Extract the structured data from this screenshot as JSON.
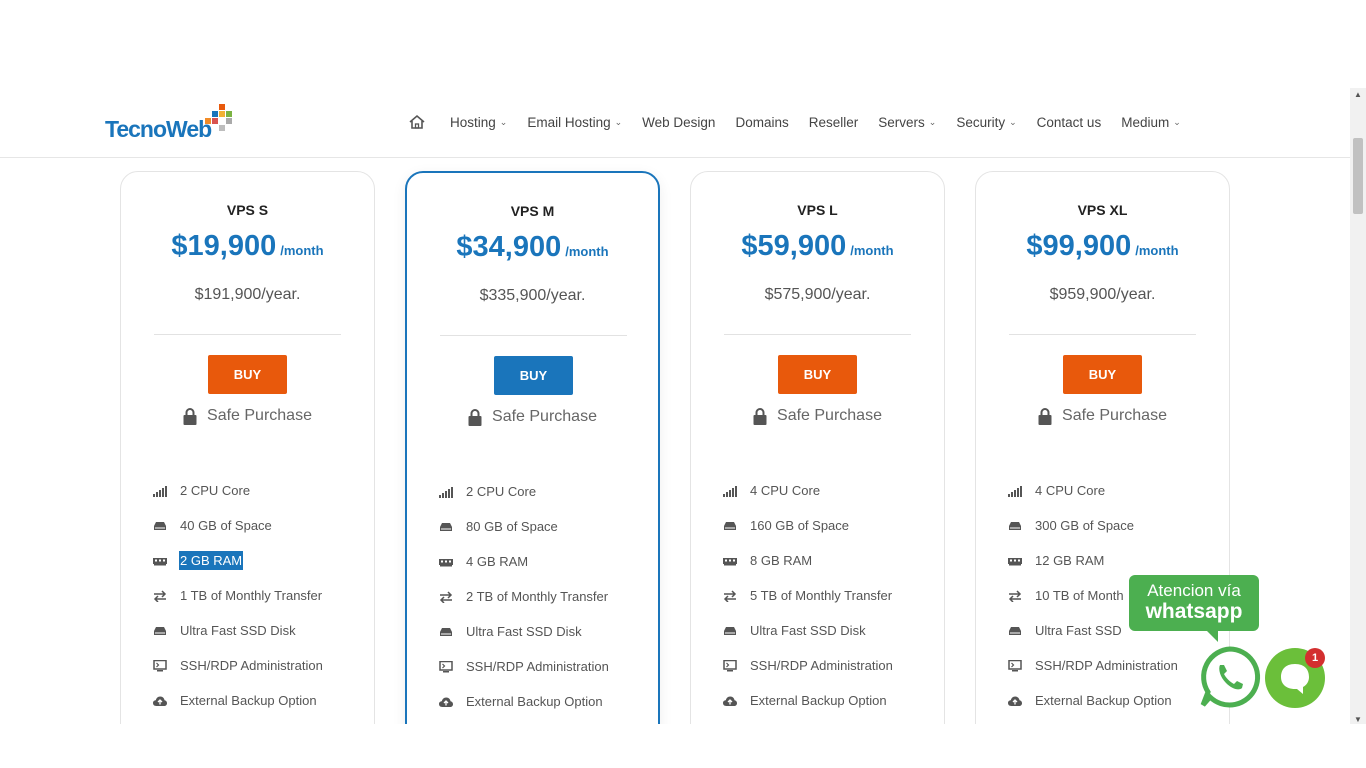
{
  "header": {
    "logo_text_1": "Tecno",
    "logo_text_2": "Web",
    "nav": [
      {
        "label": "Hosting",
        "has_dropdown": true
      },
      {
        "label": "Email Hosting",
        "has_dropdown": true
      },
      {
        "label": "Web Design",
        "has_dropdown": false
      },
      {
        "label": "Domains",
        "has_dropdown": false
      },
      {
        "label": "Reseller",
        "has_dropdown": false
      },
      {
        "label": "Servers",
        "has_dropdown": true
      },
      {
        "label": "Security",
        "has_dropdown": true
      },
      {
        "label": "Contact us",
        "has_dropdown": false
      },
      {
        "label": "Medium",
        "has_dropdown": true
      }
    ],
    "chevron": "⌄"
  },
  "plans": [
    {
      "name": "VPS S",
      "price": "$19,900",
      "per": "/month",
      "yearly": "$191,900/year.",
      "buy_label": "BUY",
      "buy_color": "#e8590c",
      "safe_label": "Safe Purchase",
      "features": [
        "2 CPU Core",
        "40 GB of Space",
        "2 GB RAM",
        "1 TB of Monthly Transfer",
        "Ultra Fast SSD Disk",
        "SSH/RDP Administration",
        "External Backup Option"
      ]
    },
    {
      "name": "VPS M",
      "price": "$34,900",
      "per": "/month",
      "yearly": "$335,900/year.",
      "buy_label": "BUY",
      "buy_color": "#1a75bb",
      "safe_label": "Safe Purchase",
      "features": [
        "2 CPU Core",
        "80 GB of Space",
        "4 GB RAM",
        "2 TB of Monthly Transfer",
        "Ultra Fast SSD Disk",
        "SSH/RDP Administration",
        "External Backup Option"
      ]
    },
    {
      "name": "VPS L",
      "price": "$59,900",
      "per": "/month",
      "yearly": "$575,900/year.",
      "buy_label": "BUY",
      "buy_color": "#e8590c",
      "safe_label": "Safe Purchase",
      "features": [
        "4 CPU Core",
        "160 GB of Space",
        "8 GB RAM",
        "5 TB of Monthly Transfer",
        "Ultra Fast SSD Disk",
        "SSH/RDP Administration",
        "External Backup Option"
      ]
    },
    {
      "name": "VPS XL",
      "price": "$99,900",
      "per": "/month",
      "yearly": "$959,900/year.",
      "buy_label": "BUY",
      "buy_color": "#e8590c",
      "safe_label": "Safe Purchase",
      "features": [
        "4 CPU Core",
        "300 GB of Space",
        "12 GB RAM",
        "10 TB of Month",
        "Ultra Fast SSD",
        "SSH/RDP Administration",
        "External Backup Option"
      ]
    }
  ],
  "feature_icons": [
    "signal-bars-icon",
    "hard-drive-icon",
    "memory-icon",
    "transfer-arrows-icon",
    "ssd-disk-icon",
    "monitor-terminal-icon",
    "cloud-upload-icon"
  ],
  "selected_feature": {
    "plan": 0,
    "feature": 2
  },
  "whatsapp": {
    "line1": "Atencion vía",
    "line2": "whatsapp",
    "badge_count": "1"
  },
  "colors": {
    "brand_blue": "#1a75bb",
    "buy_orange": "#e8590c",
    "whatsapp_green": "#4caf50"
  }
}
